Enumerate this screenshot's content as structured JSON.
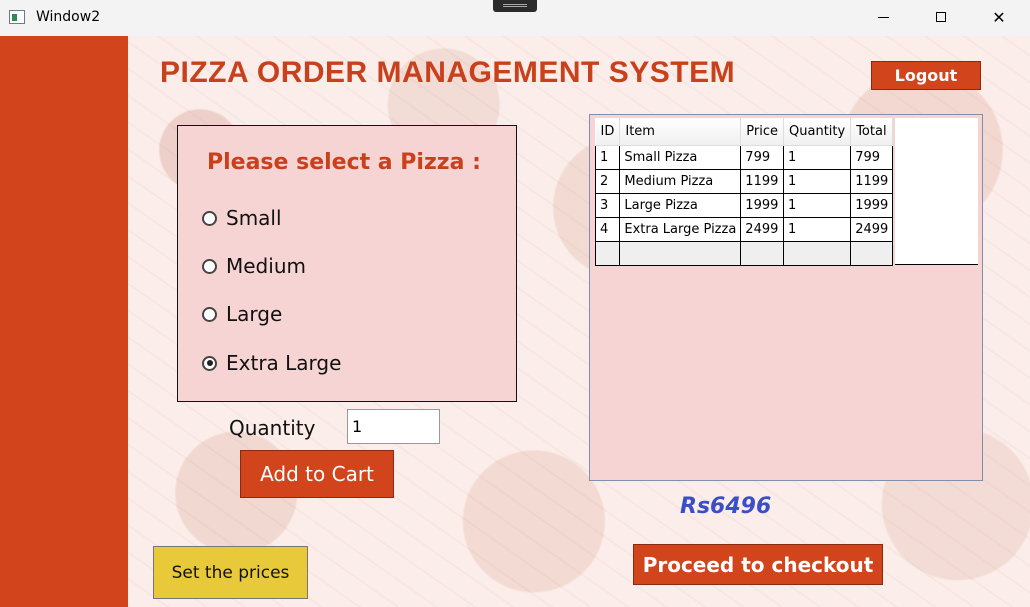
{
  "window": {
    "title": "Window2",
    "minimize": "minimize",
    "maximize": "maximize",
    "close": "✕"
  },
  "header": {
    "title": "PIZZA ORDER MANAGEMENT SYSTEM",
    "logout_label": "Logout"
  },
  "pizza_select": {
    "title": "Please select a Pizza :",
    "options": [
      {
        "label": "Small",
        "checked": false
      },
      {
        "label": "Medium",
        "checked": false
      },
      {
        "label": "Large",
        "checked": false
      },
      {
        "label": "Extra Large",
        "checked": true
      }
    ]
  },
  "quantity": {
    "label": "Quantity",
    "value": "1"
  },
  "add_to_cart_label": "Add to Cart",
  "cart": {
    "columns": [
      "ID",
      "Item",
      "Price",
      "Quantity",
      "Total"
    ],
    "rows": [
      [
        "1",
        "Small Pizza",
        "799",
        "1",
        "799"
      ],
      [
        "2",
        "Medium Pizza",
        "1199",
        "1",
        "1199"
      ],
      [
        "3",
        "Large Pizza",
        "1999",
        "1",
        "1999"
      ],
      [
        "4",
        "Extra Large Pizza",
        "2499",
        "1",
        "2499"
      ]
    ]
  },
  "total": "Rs6496",
  "checkout_label": "Proceed to checkout",
  "set_prices_label": "Set the prices",
  "colors": {
    "accent": "#d1441c",
    "panel": "#f7d4d4",
    "total_text": "#3a4fc7",
    "prices_button": "#e8c93a"
  }
}
